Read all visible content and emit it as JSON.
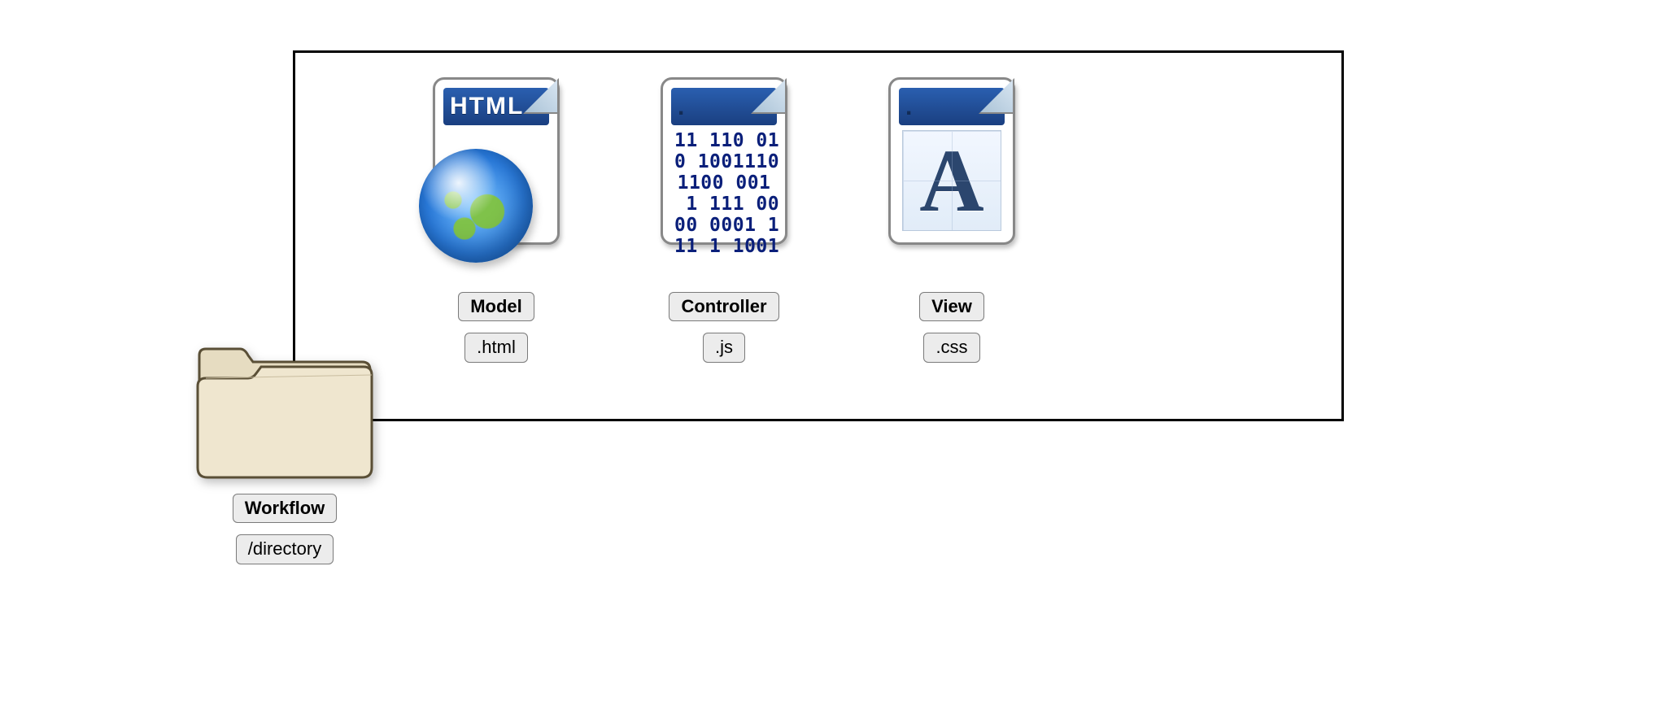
{
  "workflow": {
    "label": "Workflow",
    "sub": "/directory"
  },
  "model": {
    "label": "Model",
    "sub": ".html",
    "icon_text": "HTML"
  },
  "controller": {
    "label": "Controller",
    "sub": ".js",
    "binary_lines": [
      "11 110 01",
      "0 1001110",
      "1100 001",
      " 1 111 00",
      "00 0001 1",
      "11 1 1001"
    ]
  },
  "view": {
    "label": "View",
    "sub": ".css",
    "glyph": "A"
  }
}
